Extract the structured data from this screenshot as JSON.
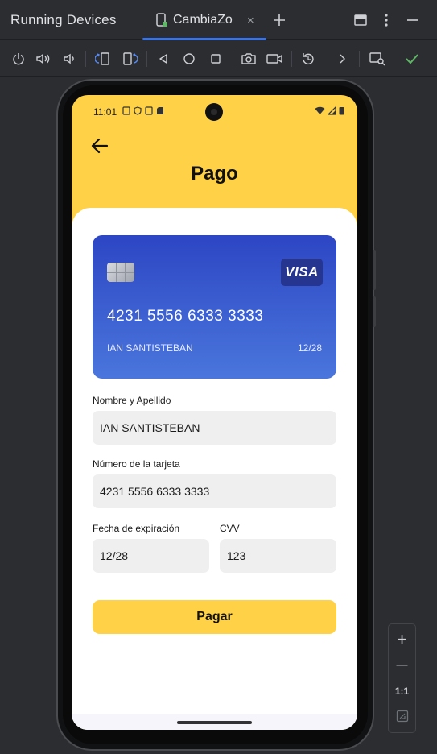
{
  "window": {
    "title": "Running Devices",
    "tab_label": "CambiaZo",
    "tab_close": "×"
  },
  "toolbar": {
    "icons": [
      "power-icon",
      "volume-up-icon",
      "volume-down-icon",
      "rotate-left-icon",
      "rotate-right-icon",
      "back-icon",
      "home-icon",
      "overview-icon",
      "screenshot-icon",
      "screen-record-icon",
      "reset-icon",
      "more-icon",
      "device-inspect-icon",
      "check-icon"
    ]
  },
  "device": {
    "status": {
      "time": "11:01"
    },
    "app": {
      "title": "Pago",
      "card": {
        "brand": "VISA",
        "number": "4231 5556 6333 3333",
        "holder": "IAN SANTISTEBAN",
        "expiry": "12/28"
      },
      "form": {
        "name_label": "Nombre y Apellido",
        "name_value": "IAN SANTISTEBAN",
        "number_label": "Número de la tarjeta",
        "number_value": "4231 5556 6333 3333",
        "expiry_label": "Fecha de expiración",
        "expiry_value": "12/28",
        "cvv_label": "CVV",
        "cvv_value": "123"
      },
      "pay_label": "Pagar"
    }
  },
  "zoom": {
    "plus": "+",
    "minus": "—",
    "ratio": "1:1"
  },
  "colors": {
    "accent": "#ffd147",
    "card_top": "#2d46c4",
    "card_bottom": "#4a76dc",
    "ide_bg": "#2b2d30",
    "tab_underline": "#3574f0",
    "check": "#5fb865"
  }
}
